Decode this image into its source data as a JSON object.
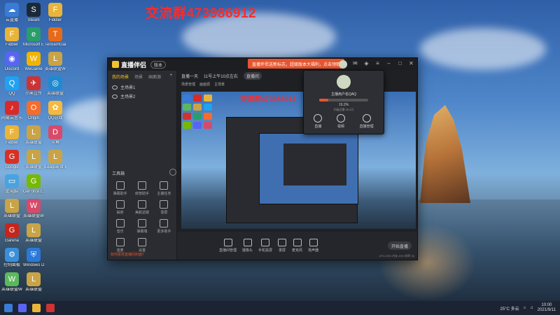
{
  "overlay_text": "交流群473986912",
  "desktop_icons": [
    {
      "label": "云直播",
      "color": "#3a7bd5",
      "glyph": "☁"
    },
    {
      "label": "Fiddler",
      "color": "#e9b43a",
      "glyph": "F"
    },
    {
      "label": "Discord",
      "color": "#5865f2",
      "glyph": "◉"
    },
    {
      "label": "QQ",
      "color": "#1fa2f1",
      "glyph": "Q"
    },
    {
      "label": "网易云音乐",
      "color": "#d82a2a",
      "glyph": "♪"
    },
    {
      "label": "Fiddler",
      "color": "#e9b43a",
      "glyph": "F"
    },
    {
      "label": "Google",
      "color": "#d93025",
      "glyph": "G"
    },
    {
      "label": "此电脑",
      "color": "#4aa3df",
      "glyph": "▭"
    },
    {
      "label": "英雄联盟",
      "color": "#c8a447",
      "glyph": "L"
    },
    {
      "label": "Garena",
      "color": "#c4261d",
      "glyph": "G"
    },
    {
      "label": "控制面板",
      "color": "#3b8ed8",
      "glyph": "⚙"
    },
    {
      "label": "英雄联盟WeGame版",
      "color": "#5cb85c",
      "glyph": "W"
    },
    {
      "label": "Steam",
      "color": "#1b2838",
      "glyph": "S"
    },
    {
      "label": "Microsoft Edge",
      "color": "#2a9d6b",
      "glyph": "e"
    },
    {
      "label": "WeGame",
      "color": "#f0b400",
      "glyph": "W"
    },
    {
      "label": "小米互传",
      "color": "#c33",
      "glyph": "✈"
    },
    {
      "label": "Origin",
      "color": "#f56c2d",
      "glyph": "O"
    },
    {
      "label": "英雄联盟",
      "color": "#c8a447",
      "glyph": "L"
    },
    {
      "label": "英雄联盟",
      "color": "#c8a447",
      "glyph": "L"
    },
    {
      "label": "GeForce Experience",
      "color": "#76b900",
      "glyph": "G"
    },
    {
      "label": "英雄联盟WeGame版",
      "color": "#d84a6a",
      "glyph": "W"
    },
    {
      "label": "英雄联盟",
      "color": "#c8a447",
      "glyph": "L"
    },
    {
      "label": "Windows Defender",
      "color": "#2b78d6",
      "glyph": "⛨"
    },
    {
      "label": "英雄联盟",
      "color": "#c8a447",
      "glyph": "L"
    },
    {
      "label": "Fiddler",
      "color": "#e9b43a",
      "glyph": "F"
    },
    {
      "label": "TencentGames",
      "color": "#e66a1a",
      "glyph": "T"
    },
    {
      "label": "英雄联盟WeGame版",
      "color": "#c8a447",
      "glyph": "L"
    },
    {
      "label": "英雄联盟",
      "color": "#1f8ad1",
      "glyph": "◎"
    },
    {
      "label": "QQ游戏",
      "color": "#f6b93b",
      "glyph": "✿"
    },
    {
      "label": "斗鱼",
      "color": "#d84a6a",
      "glyph": "D"
    },
    {
      "label": "League of Legends",
      "color": "#c8a447",
      "glyph": "L"
    }
  ],
  "app": {
    "title": "直播伴侣",
    "version_badge": "版本",
    "promo": "直播伴侣送新标志，超级版本大福利，点击领取",
    "left_tabs": [
      "我的场景",
      "场景",
      "画面源"
    ],
    "scenes": [
      "主场景1",
      "主场景2"
    ],
    "tools_title": "工具箱",
    "tools": [
      "弹幕助手",
      "房管助手",
      "主播任务",
      "抽奖",
      "美颜滤镜",
      "录屏",
      "音乐",
      "弹幕墙",
      "更多助手",
      "连麦",
      "设置"
    ],
    "footer_hint": "如何更改直播间封面？",
    "main_head": [
      "直播一天",
      "11号上午10点左右",
      "直播间"
    ],
    "main_sub": [
      "场景管理",
      "画面源",
      "主场景"
    ],
    "bottom_buttons": [
      "直播间管理",
      "摄像头",
      "手机投屏",
      "录屏",
      "麦克风",
      "扬声器"
    ],
    "start_label": "开始直播",
    "status": "CPU 20%  内存 43%  帧率 30",
    "exit_label": "退出"
  },
  "popup": {
    "name": "主播用户名QAQ",
    "progress_label": "19.2%",
    "progress": 0.192,
    "sub": "升级还需 39.6万",
    "actions": [
      "直播",
      "视频",
      "直播管理"
    ]
  },
  "taskbar": {
    "weather": "25°C 多云",
    "time": "10:00",
    "date": "2021/9/11"
  }
}
